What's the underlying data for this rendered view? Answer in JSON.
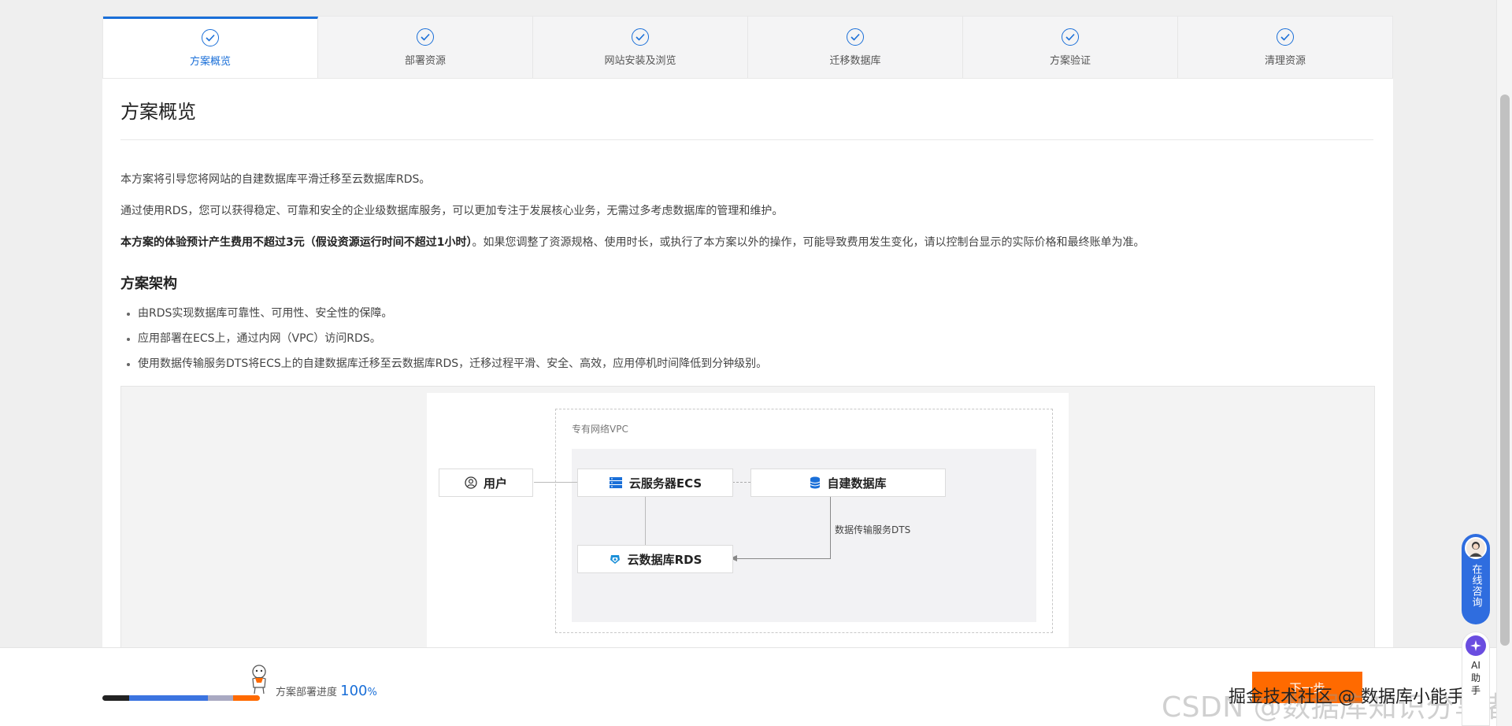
{
  "steps": [
    {
      "label": "方案概览",
      "active": true
    },
    {
      "label": "部署资源",
      "active": false
    },
    {
      "label": "网站安装及浏览",
      "active": false
    },
    {
      "label": "迁移数据库",
      "active": false
    },
    {
      "label": "方案验证",
      "active": false
    },
    {
      "label": "清理资源",
      "active": false
    }
  ],
  "content": {
    "title": "方案概览",
    "intro1": "本方案将引导您将网站的自建数据库平滑迁移至云数据库RDS。",
    "intro2": "通过使用RDS，您可以获得稳定、可靠和安全的企业级数据库服务，可以更加专注于发展核心业务，无需过多考虑数据库的管理和维护。",
    "cost_bold": "本方案的体验预计产生费用不超过3元（假设资源运行时间不超过1小时）",
    "cost_rest": "。如果您调整了资源规格、使用时长，或执行了本方案以外的操作，可能导致费用发生变化，请以控制台显示的实际价格和最终账单为准。",
    "arch_title": "方案架构",
    "bullets": [
      "由RDS实现数据库可靠性、可用性、安全性的保障。",
      "应用部署在ECS上，通过内网（VPC）访问RDS。",
      "使用数据传输服务DTS将ECS上的自建数据库迁移至云数据库RDS，迁移过程平滑、安全、高效，应用停机时间降低到分钟级别。"
    ]
  },
  "diagram": {
    "vpc_label": "专有网络VPC",
    "user": "用户",
    "ecs": "云服务器ECS",
    "selfdb": "自建数据库",
    "rds": "云数据库RDS",
    "dts": "数据传输服务DTS"
  },
  "footer": {
    "progress_label": "方案部署进度",
    "progress_value": "100",
    "progress_unit": "%",
    "progress_fraction": 1.0,
    "next_label": "下一步",
    "watermark": "CSDN @数据库知识分享者",
    "overlay_text": "掘金技术社区 @ 数据库小能手"
  },
  "floating": {
    "consult": "在线咨询",
    "ai": "AI助手"
  },
  "colors": {
    "accent": "#1a6fd8",
    "orange": "#ff6a00"
  }
}
